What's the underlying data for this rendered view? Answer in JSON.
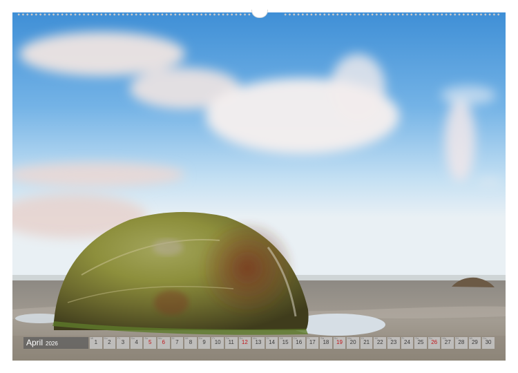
{
  "calendar": {
    "month": "April",
    "year": "2026",
    "days": [
      {
        "num": "1",
        "wd": "Mi",
        "sunday": false
      },
      {
        "num": "2",
        "wd": "Do",
        "sunday": false
      },
      {
        "num": "3",
        "wd": "Fr",
        "sunday": false
      },
      {
        "num": "4",
        "wd": "Sa",
        "sunday": false
      },
      {
        "num": "5",
        "wd": "So",
        "sunday": true
      },
      {
        "num": "6",
        "wd": "Mo",
        "sunday": true
      },
      {
        "num": "7",
        "wd": "Di",
        "sunday": false
      },
      {
        "num": "8",
        "wd": "Mi",
        "sunday": false
      },
      {
        "num": "9",
        "wd": "Do",
        "sunday": false
      },
      {
        "num": "10",
        "wd": "Fr",
        "sunday": false
      },
      {
        "num": "11",
        "wd": "Sa",
        "sunday": false
      },
      {
        "num": "12",
        "wd": "So",
        "sunday": true
      },
      {
        "num": "13",
        "wd": "Mo",
        "sunday": false
      },
      {
        "num": "14",
        "wd": "Di",
        "sunday": false
      },
      {
        "num": "15",
        "wd": "Mi",
        "sunday": false
      },
      {
        "num": "16",
        "wd": "Do",
        "sunday": false
      },
      {
        "num": "17",
        "wd": "Fr",
        "sunday": false
      },
      {
        "num": "18",
        "wd": "Sa",
        "sunday": false
      },
      {
        "num": "19",
        "wd": "So",
        "sunday": true
      },
      {
        "num": "20",
        "wd": "Mo",
        "sunday": false
      },
      {
        "num": "21",
        "wd": "Di",
        "sunday": false
      },
      {
        "num": "22",
        "wd": "Mi",
        "sunday": false
      },
      {
        "num": "23",
        "wd": "Do",
        "sunday": false
      },
      {
        "num": "24",
        "wd": "Fr",
        "sunday": false
      },
      {
        "num": "25",
        "wd": "Sa",
        "sunday": false
      },
      {
        "num": "26",
        "wd": "So",
        "sunday": true
      },
      {
        "num": "27",
        "wd": "Mo",
        "sunday": false
      },
      {
        "num": "28",
        "wd": "Di",
        "sunday": false
      },
      {
        "num": "29",
        "wd": "Mi",
        "sunday": false
      },
      {
        "num": "30",
        "wd": "Do",
        "sunday": false
      }
    ]
  },
  "colors": {
    "sunday": "#c0161c",
    "day_text": "#3a3a3a",
    "month_box": "#5c5c5c",
    "day_box": "#c8c8c8"
  },
  "icons": {
    "binding": "ring-binding-dots",
    "hanger": "wall-hanger-notch"
  }
}
